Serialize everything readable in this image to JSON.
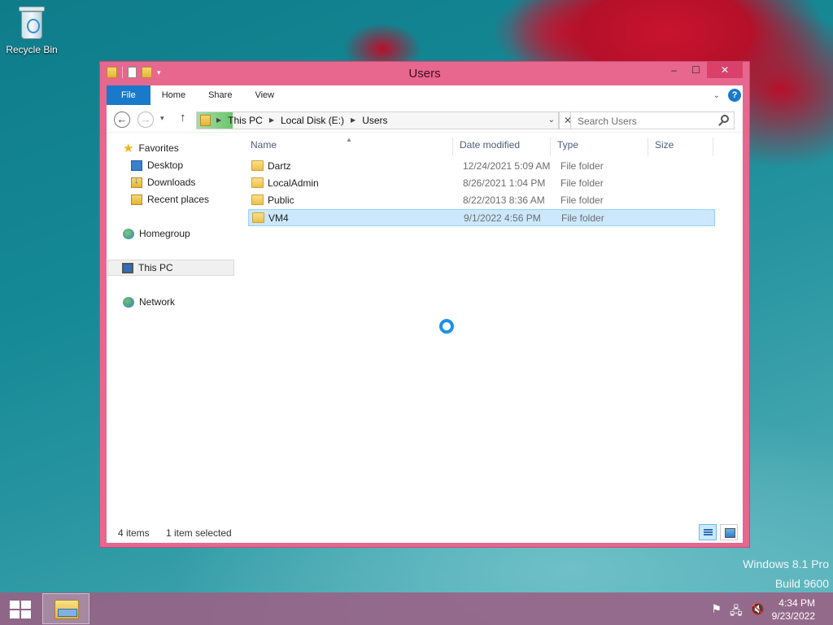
{
  "desktop": {
    "recycle_bin_label": "Recycle Bin",
    "watermark_line1": "Windows 8.1 Pro",
    "watermark_line2": "Build 9600"
  },
  "window": {
    "title": "Users",
    "controls": {
      "minimize": "–",
      "maximize": "☐",
      "close": "✕"
    },
    "ribbon_tabs": [
      "File",
      "Home",
      "Share",
      "View"
    ],
    "ribbon_collapse": "⌄",
    "help": "?"
  },
  "navigation": {
    "back": "←",
    "forward": "→",
    "recent": "▾",
    "up": "↑",
    "breadcrumb": [
      "This PC",
      "Local Disk (E:)",
      "Users"
    ],
    "address_dropdown": "⌄",
    "address_clear": "✕",
    "search_placeholder": "Search Users"
  },
  "nav_pane": {
    "favorites": "Favorites",
    "favorites_items": [
      "Desktop",
      "Downloads",
      "Recent places"
    ],
    "homegroup": "Homegroup",
    "this_pc": "This PC",
    "network": "Network"
  },
  "columns": [
    "Name",
    "Date modified",
    "Type",
    "Size"
  ],
  "files": [
    {
      "name": "Dartz",
      "date": "12/24/2021 5:09 AM",
      "type": "File folder"
    },
    {
      "name": "LocalAdmin",
      "date": "8/26/2021 1:04 PM",
      "type": "File folder"
    },
    {
      "name": "Public",
      "date": "8/22/2013 8:36 AM",
      "type": "File folder"
    },
    {
      "name": "VM4",
      "date": "9/1/2022 4:56 PM",
      "type": "File folder"
    }
  ],
  "status": {
    "item_count": "4 items",
    "selected": "1 item selected"
  },
  "taskbar": {
    "time": "4:34 PM",
    "date": "9/23/2022",
    "tray_icons": [
      "flag-icon",
      "network-icon",
      "volume-muted-icon"
    ]
  },
  "colors": {
    "window_frame": "#e8678e",
    "accent": "#1979ca",
    "selection": "#cce8ff"
  }
}
